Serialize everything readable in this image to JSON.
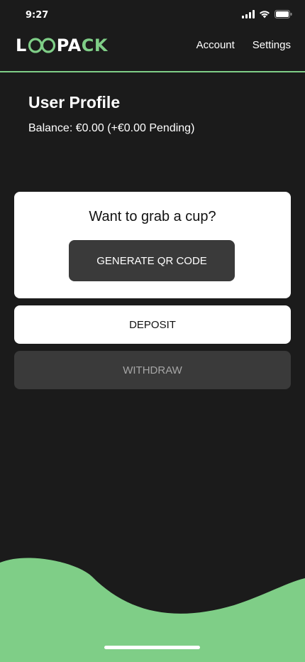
{
  "status_bar": {
    "time": "9:27"
  },
  "header": {
    "logo_prefix": "L",
    "logo_middle": "PA",
    "logo_suffix": "CK",
    "nav": {
      "account": "Account",
      "settings": "Settings"
    }
  },
  "profile": {
    "title": "User Profile",
    "balance": "Balance: €0.00 (+€0.00 Pending)"
  },
  "qr_card": {
    "heading": "Want to grab a cup?",
    "button_label": "GENERATE QR CODE"
  },
  "actions": {
    "deposit_label": "DEPOSIT",
    "withdraw_label": "WITHDRAW"
  },
  "colors": {
    "background": "#1b1b1b",
    "accent": "#7fce87",
    "dark_button": "#3a3a3a",
    "card": "#ffffff"
  },
  "icons": {
    "signal": "cellular-signal-icon",
    "wifi": "wifi-icon",
    "battery": "battery-icon"
  }
}
